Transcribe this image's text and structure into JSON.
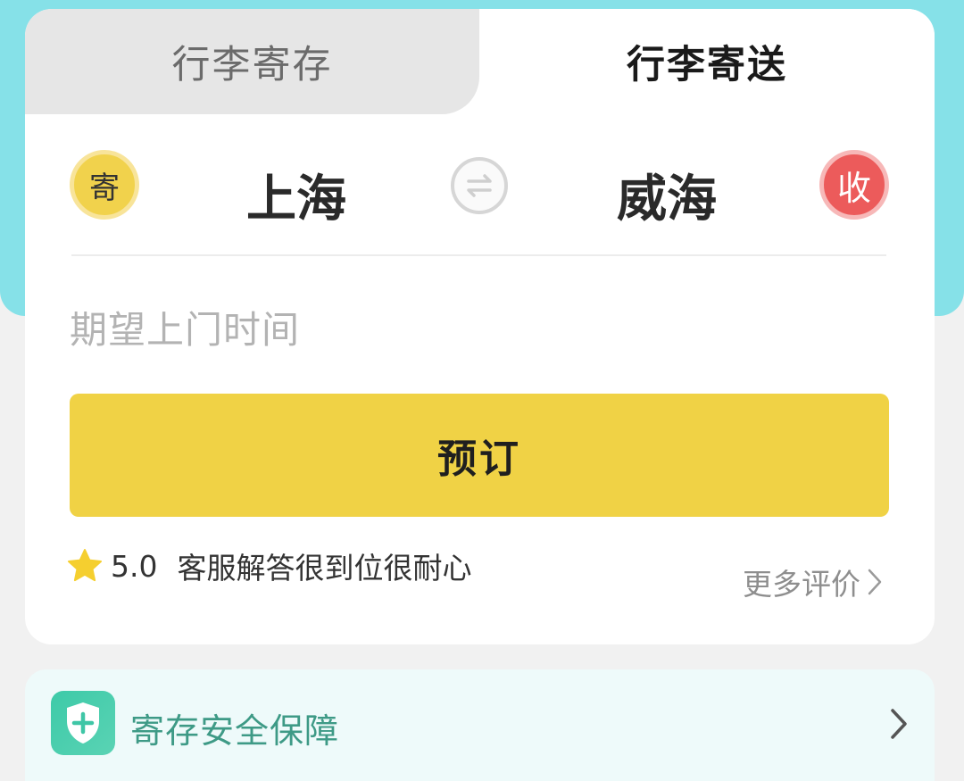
{
  "tabs": {
    "storage": "行李寄存",
    "delivery": "行李寄送"
  },
  "route": {
    "send_badge": "寄",
    "from_city": "上海",
    "to_city": "威海",
    "receive_badge": "收"
  },
  "form": {
    "time_placeholder": "期望上门时间"
  },
  "book_button": "预订",
  "review": {
    "rating": "5.0",
    "text": "客服解答很到位很耐心",
    "more_label": "更多评价"
  },
  "safety": {
    "label": "寄存安全保障"
  },
  "colors": {
    "hero_bg": "#86e1e8",
    "button": "#f0d245",
    "send_badge": "#f1d24c",
    "receive_badge": "#ec5b5b",
    "safety_text": "#3e9a86",
    "star": "#f5cf2f"
  }
}
